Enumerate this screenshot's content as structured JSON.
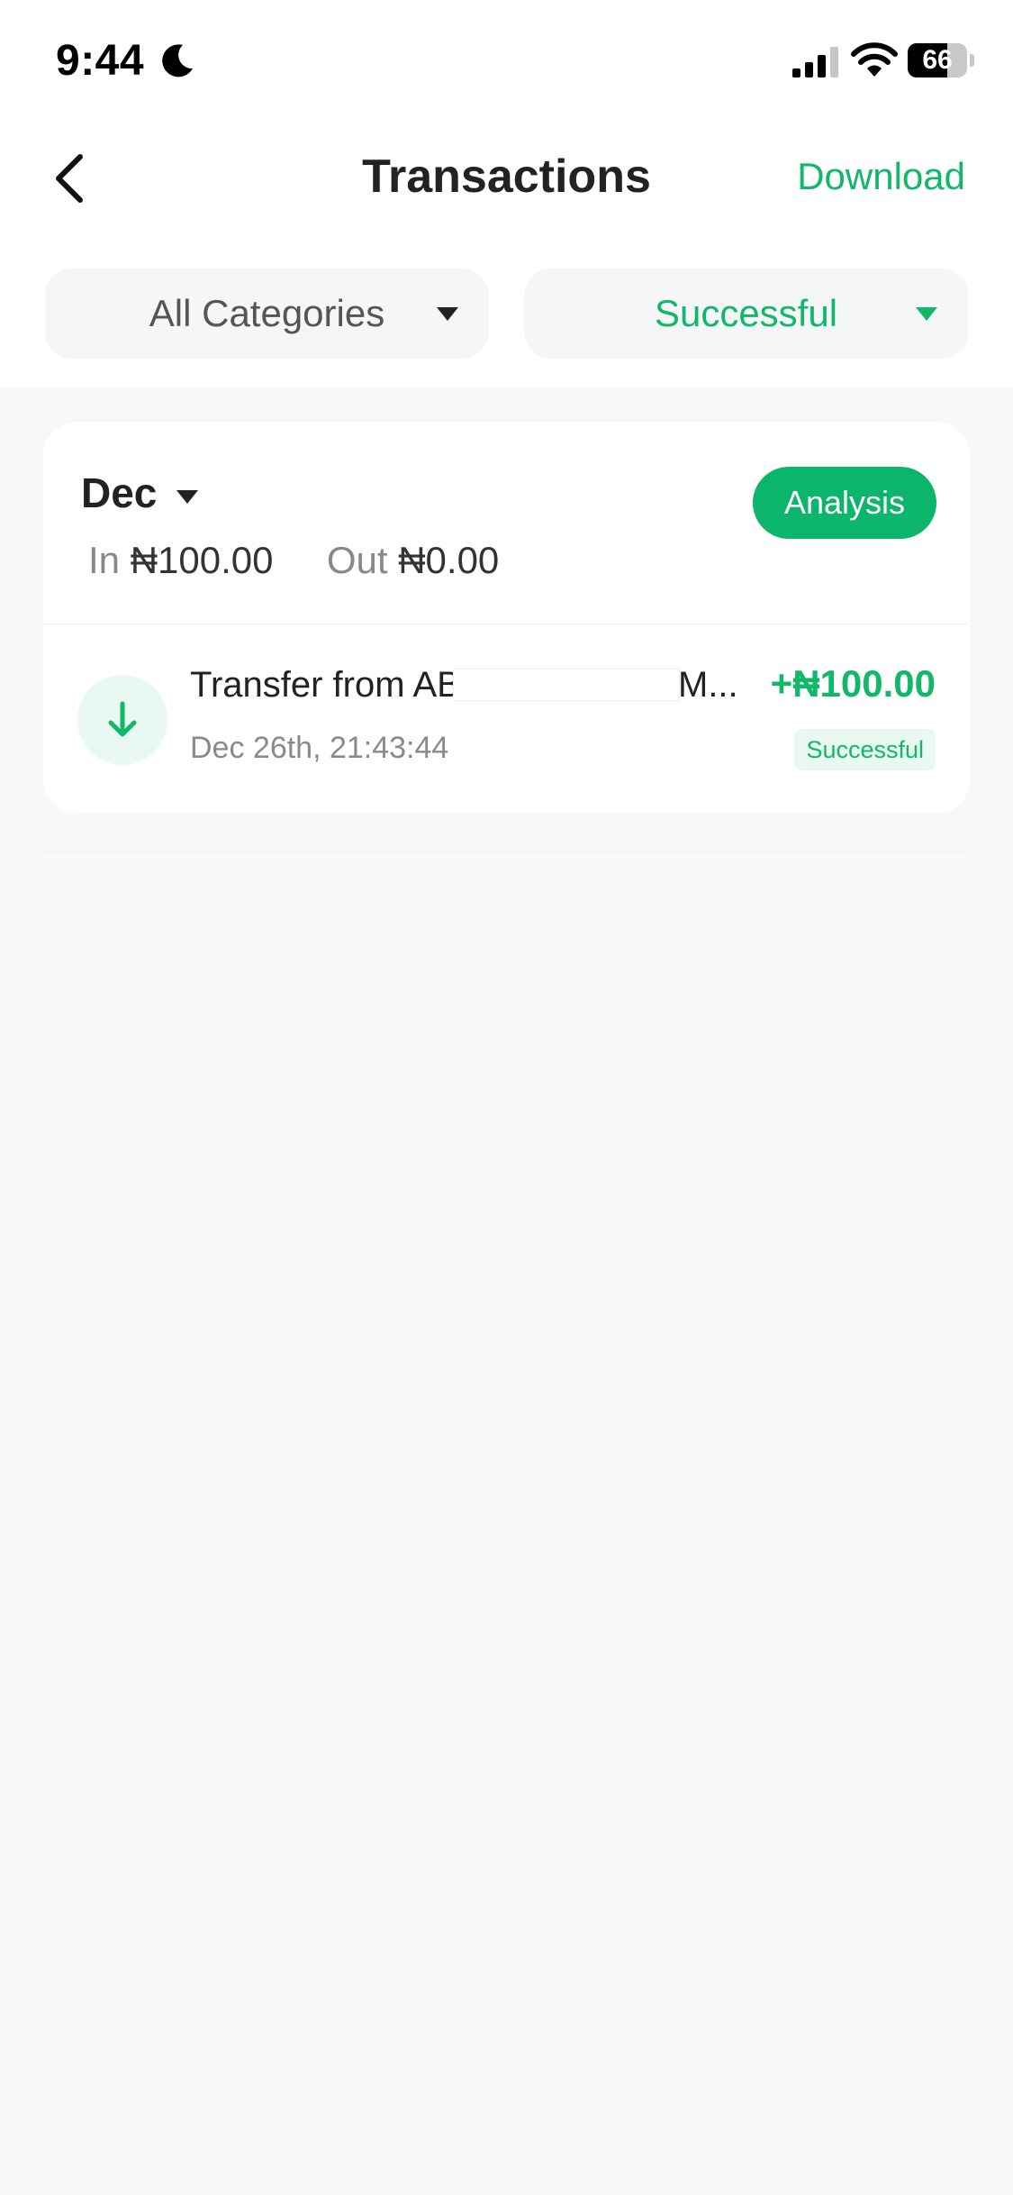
{
  "status_bar": {
    "time": "9:44",
    "battery_percent": 66,
    "battery_text": "66"
  },
  "header": {
    "title": "Transactions",
    "download_label": "Download"
  },
  "filters": {
    "category": "All Categories",
    "status": "Successful"
  },
  "summary": {
    "month": "Dec",
    "in_label": "In",
    "in_value": "₦100.00",
    "out_label": "Out",
    "out_value": "₦0.00",
    "analysis_label": "Analysis"
  },
  "transactions": [
    {
      "title_visible_start": "Transfer from AB",
      "title_visible_end": "M...",
      "date": "Dec 26th, 21:43:44",
      "amount": "+₦100.00",
      "status": "Successful"
    }
  ],
  "colors": {
    "accent": "#12b76a",
    "button": "#0bb56c",
    "background": "#f7f8fa"
  }
}
